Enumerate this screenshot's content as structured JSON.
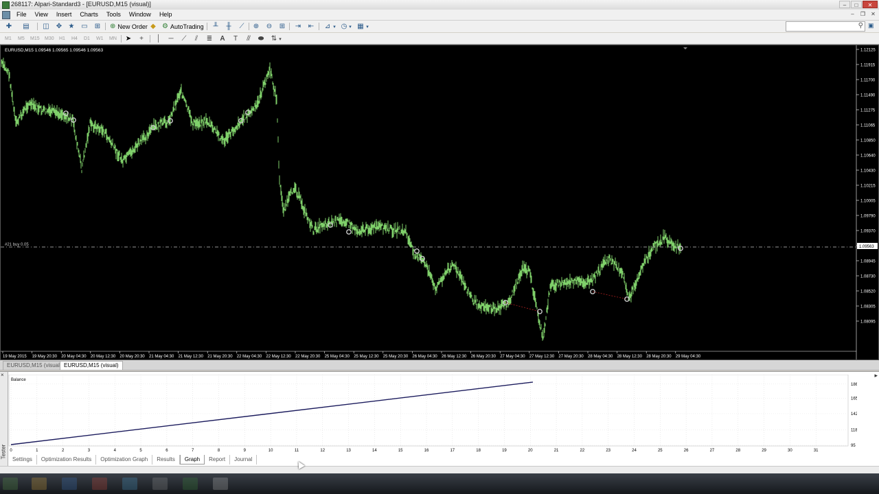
{
  "window": {
    "title": "268117: Alpari-Standard3 - [EURUSD,M15 (visual)]",
    "controls": [
      "–",
      "□",
      "✕"
    ]
  },
  "menu": {
    "items": [
      "File",
      "View",
      "Insert",
      "Charts",
      "Tools",
      "Window",
      "Help"
    ],
    "mdi_controls": [
      "–",
      "❐",
      "✕"
    ]
  },
  "toolbar": {
    "new_order": "New Order",
    "autotrading": "AutoTrading",
    "timeframes": [
      "M1",
      "M5",
      "M15",
      "M30",
      "H1",
      "H4",
      "D1",
      "W1",
      "MN"
    ]
  },
  "chart": {
    "header": "EURUSD,M15  1.09546 1.09565 1.09546 1.09563",
    "order_label": "#21 buy 0.05",
    "current_price": "1.09563",
    "price_ticks": [
      "1.12125",
      "1.11915",
      "1.11700",
      "1.11490",
      "1.11275",
      "1.11065",
      "1.10850",
      "1.10640",
      "1.10430",
      "1.10215",
      "1.10005",
      "1.09790",
      "1.09370",
      "1.09155",
      "1.08945",
      "1.08730",
      "1.08520",
      "1.08305",
      "1.08095"
    ],
    "time_ticks": [
      "19 May 2015",
      "19 May 20:30",
      "20 May 04:30",
      "20 May 12:30",
      "20 May 20:30",
      "21 May 04:30",
      "21 May 12:30",
      "21 May 20:30",
      "22 May 04:30",
      "22 May 12:30",
      "22 May 20:30",
      "25 May 04:30",
      "25 May 12:30",
      "25 May 20:30",
      "26 May 04:30",
      "26 May 12:30",
      "26 May 20:30",
      "27 May 04:30",
      "27 May 12:30",
      "27 May 20:30",
      "28 May 04:30",
      "28 May 12:30",
      "28 May 20:30",
      "29 May 04:30"
    ],
    "colors": {
      "background": "#000000",
      "candles": "#7fd06a",
      "text": "#ffffff",
      "order_line": "#c8c8c8",
      "trade_marker": "#c9c9c9",
      "loss_line": "#b02020"
    }
  },
  "chart_tabs": [
    "EURUSD,M15 (visual)",
    "EURUSD,M15 (visual)"
  ],
  "tester": {
    "side_label": "Tester",
    "close": "×",
    "graph": {
      "legend": "Balance",
      "line_color": "#1a1a5c",
      "y_ticks": [
        "186",
        "165",
        "142",
        "118",
        "95"
      ],
      "x_ticks": [
        "0",
        "1",
        "2",
        "3",
        "4",
        "5",
        "6",
        "7",
        "8",
        "9",
        "10",
        "11",
        "12",
        "13",
        "14",
        "15",
        "16",
        "17",
        "18",
        "19",
        "20",
        "21",
        "22",
        "23",
        "24",
        "25",
        "26",
        "27",
        "28",
        "29",
        "30",
        "31"
      ]
    },
    "tabs": [
      "Settings",
      "Optimization Results",
      "Optimization Graph",
      "Results",
      "Graph",
      "Report",
      "Journal"
    ],
    "active_tab": "Graph"
  },
  "chart_data": {
    "type": "line",
    "title": "Balance",
    "xlabel": "",
    "ylabel": "",
    "x": [
      0,
      20.1
    ],
    "series": [
      {
        "name": "Balance",
        "values": [
          96,
          189
        ]
      }
    ],
    "xlim": [
      0,
      32
    ],
    "ylim": [
      94,
      196
    ],
    "grid": true
  }
}
